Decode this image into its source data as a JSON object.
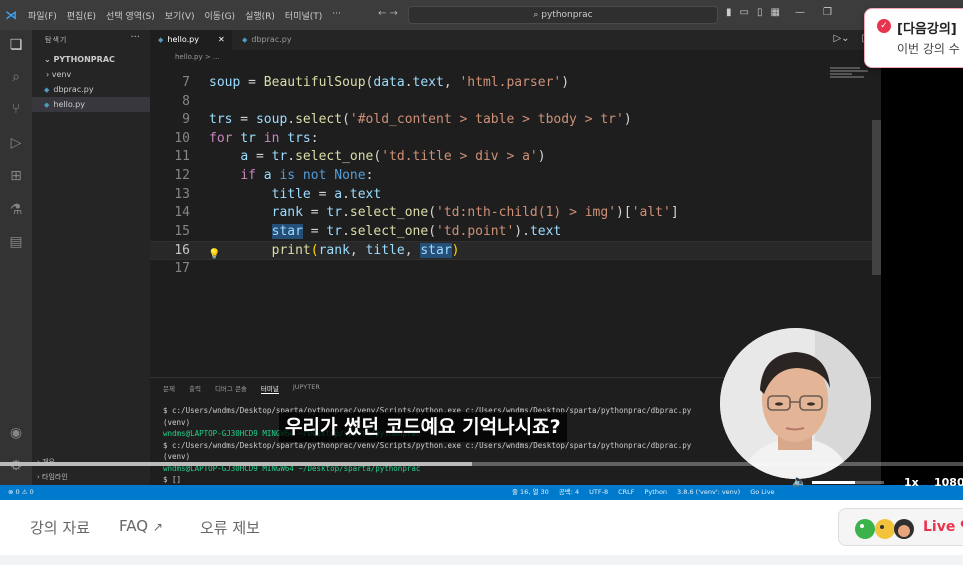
{
  "titlebar": {
    "menu": [
      "파일(F)",
      "편집(E)",
      "선택 영역(S)",
      "보기(V)",
      "이동(G)",
      "실행(R)",
      "터미널(T)",
      "···"
    ],
    "search": "pythonprac"
  },
  "sidebar": {
    "header": "탐색기",
    "project": "PYTHONPRAC",
    "items": [
      {
        "label": "venv",
        "type": "folder"
      },
      {
        "label": "dbprac.py",
        "type": "file"
      },
      {
        "label": "hello.py",
        "type": "file"
      }
    ],
    "outline": [
      "개요",
      "타임라인"
    ]
  },
  "tabs": [
    {
      "label": "hello.py",
      "active": true
    },
    {
      "label": "dbprac.py",
      "active": false
    }
  ],
  "breadcrumb": "hello.py > ...",
  "editor": {
    "current_line": 16,
    "lines": [
      {
        "n": "7",
        "html": "<span class=\"v\">soup</span> = <span class=\"f\">BeautifulSoup</span>(<span class=\"v\">data</span>.<span class=\"v\">text</span>, <span class=\"s\">'html.parser'</span>)"
      },
      {
        "n": "8",
        "html": ""
      },
      {
        "n": "9",
        "html": "<span class=\"v\">trs</span> = <span class=\"v\">soup</span>.<span class=\"f\">select</span>(<span class=\"s\">'#old_content &gt; table &gt; tbody &gt; tr'</span>)"
      },
      {
        "n": "10",
        "html": "<span class=\"k\">for</span> <span class=\"v\">tr</span> <span class=\"k\">in</span> <span class=\"v\">trs</span>:"
      },
      {
        "n": "11",
        "html": "    <span class=\"v\">a</span> = <span class=\"v\">tr</span>.<span class=\"f\">select_one</span>(<span class=\"s\">'td.title &gt; div &gt; a'</span>)"
      },
      {
        "n": "12",
        "html": "    <span class=\"k\">if</span> <span class=\"v\">a</span> <span class=\"kb\">is not</span> <span class=\"kb\">None</span>:"
      },
      {
        "n": "13",
        "html": "        <span class=\"v\">title</span> = <span class=\"v\">a</span>.<span class=\"v\">text</span>"
      },
      {
        "n": "14",
        "html": "        <span class=\"v\">rank</span> = <span class=\"v\">tr</span>.<span class=\"f\">select_one</span>(<span class=\"s\">'td:nth-child(1) &gt; img'</span>)[<span class=\"s\">'alt'</span>]"
      },
      {
        "n": "15",
        "html": "        <span class=\"v sel\">star</span> = <span class=\"v\">tr</span>.<span class=\"f\">select_one</span>(<span class=\"s\">'td.point'</span>).<span class=\"v\">text</span>"
      },
      {
        "n": "16",
        "html": "        <span class=\"f\">print</span><span class=\"br\">(</span><span class=\"v\">rank</span>, <span class=\"v\">title</span>, <span class=\"v sel\">star</span><span class=\"br\">)</span>"
      },
      {
        "n": "17",
        "html": ""
      }
    ]
  },
  "panel": {
    "tabs": [
      "문제",
      "출력",
      "디버그 콘솔",
      "터미널",
      "JUPYTER"
    ],
    "active_tab": "터미널",
    "terminal": [
      {
        "text": "$ c:/Users/wndms/Desktop/sparta/pythonprac/venv/Scripts/python.exe c:/Users/wndms/Desktop/sparta/pythonprac/dbprac.py",
        "green": false
      },
      {
        "text": "(venv)",
        "green": false
      },
      {
        "text": "wndms@LAPTOP-GJ30HCD9 MINGW64 ~/Desktop/sparta/pythonprac",
        "green": true
      },
      {
        "text": "$ c:/Users/wndms/Desktop/sparta/pythonprac/venv/Scripts/python.exe c:/Users/wndms/Desktop/sparta/pythonprac/dbprac.py",
        "green": false
      },
      {
        "text": "(venv)",
        "green": false
      },
      {
        "text": "wndms@LAPTOP-GJ30HCD9 MINGW64 ~/Desktop/sparta/pythonprac",
        "green": true
      },
      {
        "text": "$ []",
        "green": false
      }
    ]
  },
  "statusbar": {
    "left": "⊗ 0 ⚠ 0",
    "right": [
      "줄 16, 열 30",
      "공백: 4",
      "UTF-8",
      "CRLF",
      "Python",
      "3.8.6 ('venv': venv)",
      "Go Live"
    ]
  },
  "subtitle": "우리가 썼던 코드예요 기억나시죠?",
  "player": {
    "progress": 0.49,
    "volume": 0.6,
    "speed": "1x",
    "quality": "1080"
  },
  "notify": {
    "title": "[다음강의]",
    "body": "이번 강의 수"
  },
  "bottombar": {
    "materials": "강의 자료",
    "faq": "FAQ",
    "report": "오류 제보",
    "live": "Live"
  },
  "colors": {
    "accent": "#007acc",
    "live": "#e8344e"
  }
}
